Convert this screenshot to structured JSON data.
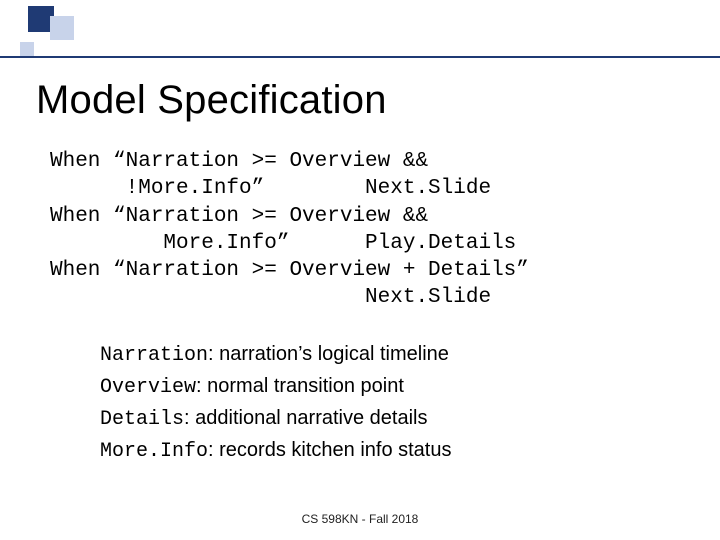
{
  "title": "Model Specification",
  "code": "When “Narration >= Overview &&\n      !More.Info”        Next.Slide\nWhen “Narration >= Overview &&\n         More.Info”      Play.Details\nWhen “Narration >= Overview + Details”\n                         Next.Slide",
  "defs": [
    {
      "term": "Narration",
      "desc": ": narration’s logical timeline"
    },
    {
      "term": "Overview",
      "desc": ": normal transition point"
    },
    {
      "term": "Details",
      "desc": ": additional narrative details"
    },
    {
      "term": "More.Info",
      "desc": ": records kitchen info status"
    }
  ],
  "footer": "CS 598KN - Fall 2018"
}
